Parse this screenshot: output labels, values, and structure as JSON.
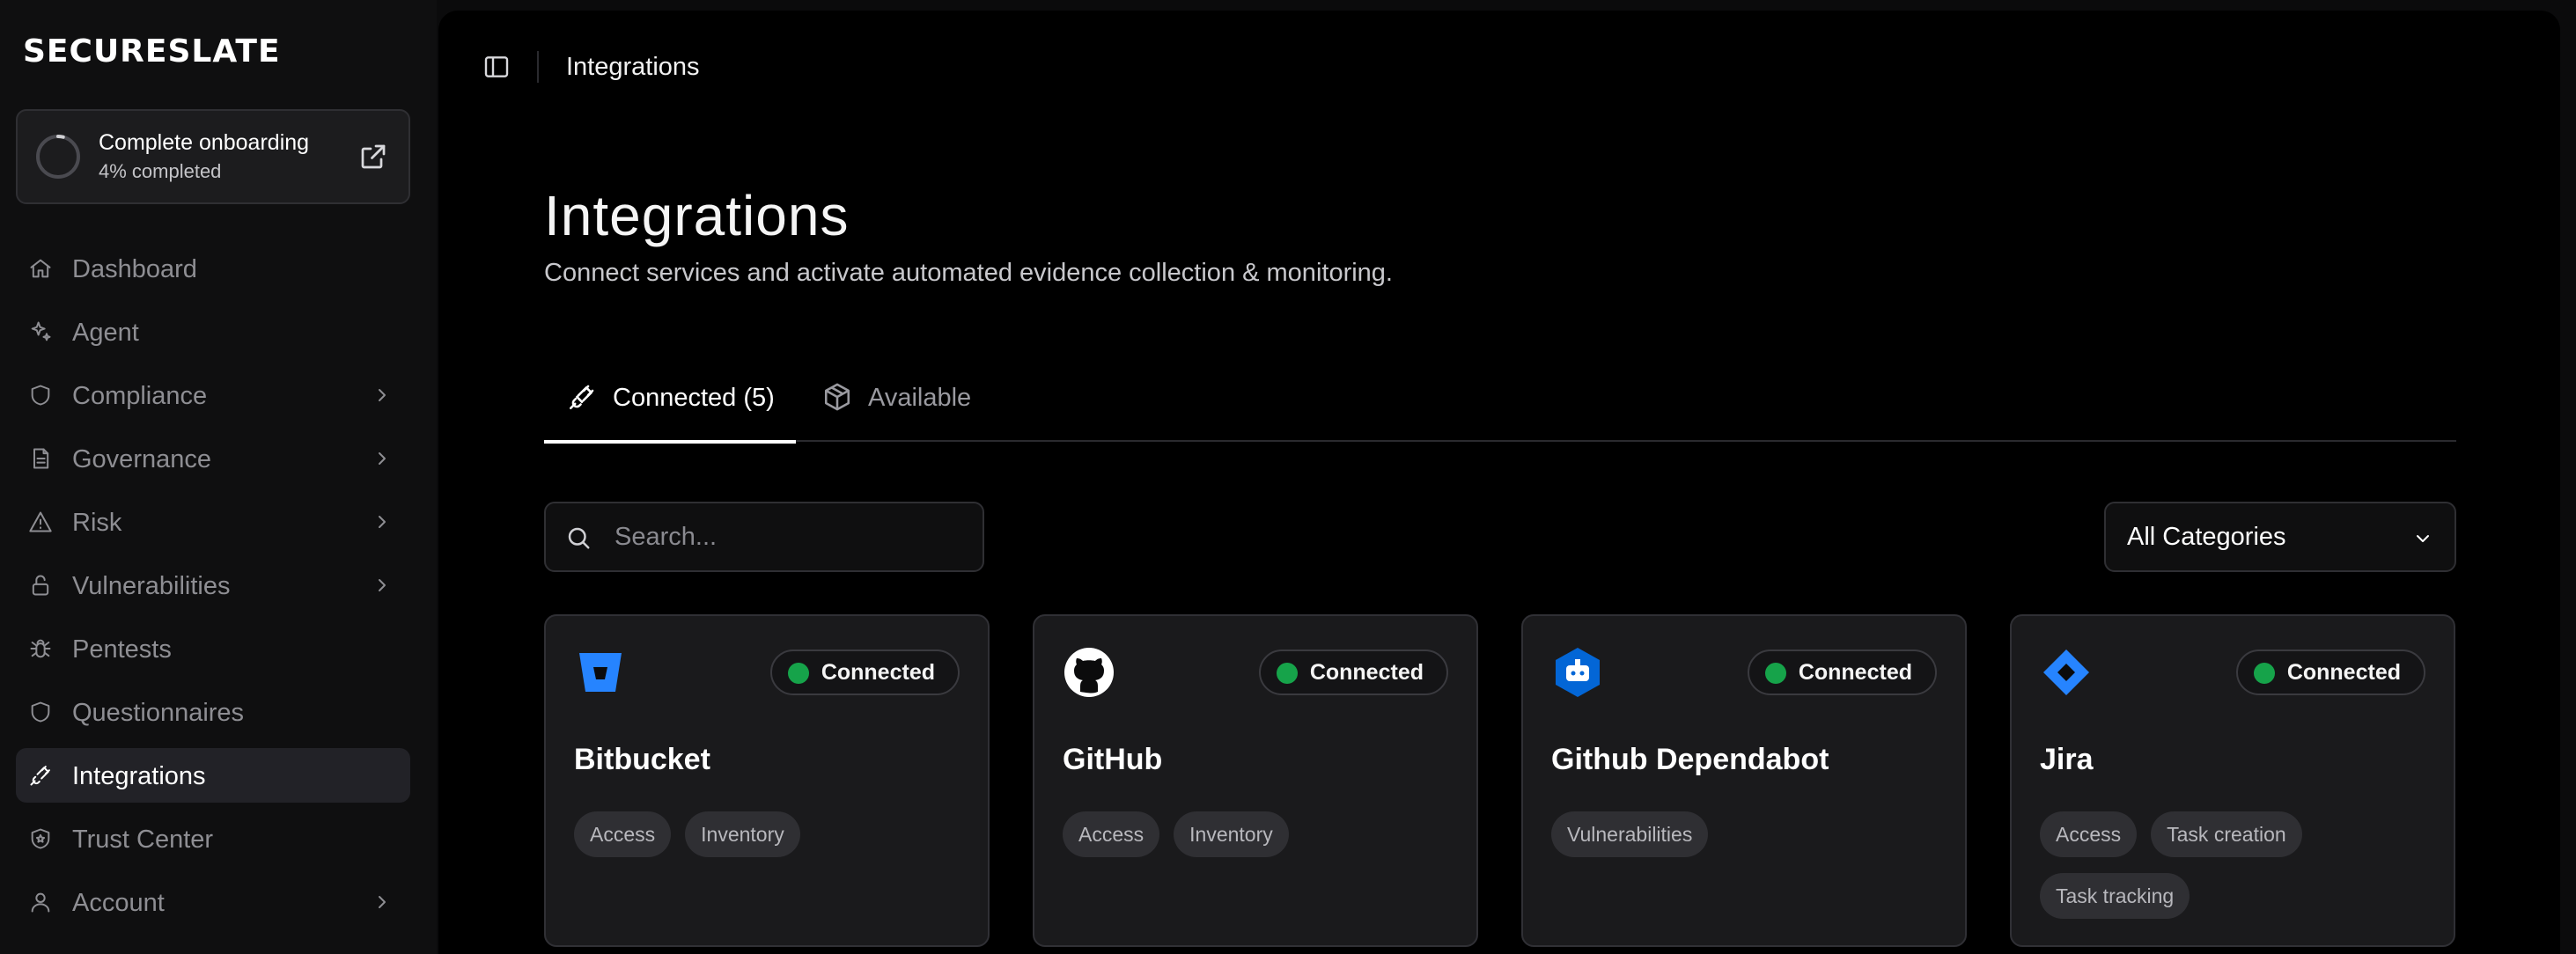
{
  "app": {
    "logo_text": "SECURESLATE"
  },
  "onboarding": {
    "title": "Complete onboarding",
    "progress_text": "4% completed",
    "progress_value": 0.04
  },
  "sidebar": {
    "items": [
      {
        "label": "Dashboard",
        "icon": "home-icon",
        "has_children": false,
        "active": false
      },
      {
        "label": "Agent",
        "icon": "sparkles-icon",
        "has_children": false,
        "active": false
      },
      {
        "label": "Compliance",
        "icon": "shield-icon",
        "has_children": true,
        "active": false
      },
      {
        "label": "Governance",
        "icon": "document-icon",
        "has_children": true,
        "active": false
      },
      {
        "label": "Risk",
        "icon": "warning-triangle-icon",
        "has_children": true,
        "active": false
      },
      {
        "label": "Vulnerabilities",
        "icon": "lock-icon",
        "has_children": true,
        "active": false
      },
      {
        "label": "Pentests",
        "icon": "bug-icon",
        "has_children": false,
        "active": false
      },
      {
        "label": "Questionnaires",
        "icon": "shield-outline-icon",
        "has_children": false,
        "active": false
      },
      {
        "label": "Integrations",
        "icon": "plug-icon",
        "has_children": false,
        "active": true
      },
      {
        "label": "Trust Center",
        "icon": "shield-star-icon",
        "has_children": false,
        "active": false
      },
      {
        "label": "Account",
        "icon": "user-icon",
        "has_children": true,
        "active": false
      }
    ]
  },
  "header": {
    "breadcrumb": "Integrations"
  },
  "page": {
    "title": "Integrations",
    "subtitle": "Connect services and activate automated evidence collection & monitoring."
  },
  "tabs": [
    {
      "label": "Connected (5)",
      "icon": "plug-icon",
      "selected": true
    },
    {
      "label": "Available",
      "icon": "package-icon",
      "selected": false
    }
  ],
  "search": {
    "placeholder": "Search...",
    "value": ""
  },
  "category_filter": {
    "selected": "All Categories"
  },
  "colors": {
    "accent_connected": "#16a34a",
    "bitbucket": "#2684FF",
    "dependabot": "#0366D6",
    "jira": "#2684FF",
    "active_nav_bg": "#222227"
  },
  "integrations": [
    {
      "name": "Bitbucket",
      "logo": "bitbucket-logo-icon",
      "status": "Connected",
      "tags": [
        "Access",
        "Inventory"
      ]
    },
    {
      "name": "GitHub",
      "logo": "github-logo-icon",
      "status": "Connected",
      "tags": [
        "Access",
        "Inventory"
      ]
    },
    {
      "name": "Github Dependabot",
      "logo": "dependabot-logo-icon",
      "status": "Connected",
      "tags": [
        "Vulnerabilities"
      ]
    },
    {
      "name": "Jira",
      "logo": "jira-logo-icon",
      "status": "Connected",
      "tags": [
        "Access",
        "Task creation",
        "Task tracking"
      ]
    }
  ]
}
